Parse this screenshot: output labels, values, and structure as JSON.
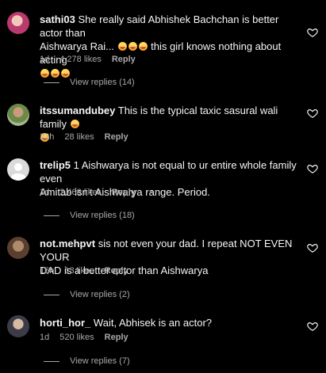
{
  "comments": [
    {
      "username": "sathi03",
      "text_line1": "She really said Abhishek Bachchan is better actor than",
      "text_line2": "Aishwarya Rai...",
      "text_line2_after": "this girl knows nothing about acting",
      "time": "1d",
      "likes": "4,278 likes",
      "reply_label": "Reply",
      "view_replies": "View replies (14)"
    },
    {
      "username": "itssumandubey",
      "text_line1": "This is the typical taxic sasural wali family",
      "time": "23h",
      "likes": "28 likes",
      "reply_label": "Reply"
    },
    {
      "username": "trelip5",
      "text_line1": "1 Aishwarya is not equal to ur entire whole family even",
      "text_line2": "Amitab isn't Aishwarya range. Period.",
      "time": "1d",
      "likes": "2,468 likes",
      "reply_label": "Reply",
      "more": "···",
      "view_replies": "View replies (18)"
    },
    {
      "username": "not.mehpvt",
      "text_line1": "sis not even your dad. I repeat NOT EVEN YOUR",
      "text_line2": "DAD is a better actor than Aishwarya",
      "time": "16h",
      "likes": "13 likes",
      "reply_label": "Reply",
      "view_replies": "View replies (2)"
    },
    {
      "username": "horti_hor_",
      "text_line1": "Wait, Abhisek is an actor?",
      "time": "1d",
      "likes": "520 likes",
      "reply_label": "Reply",
      "view_replies": "View replies (7)"
    }
  ],
  "colors": {
    "background": "#000000",
    "text_primary": "#f5f5f5",
    "text_secondary": "#a8a8a8"
  },
  "icons": [
    "heart-outline-icon",
    "laughing-emoji-icon",
    "default-avatar-icon"
  ]
}
